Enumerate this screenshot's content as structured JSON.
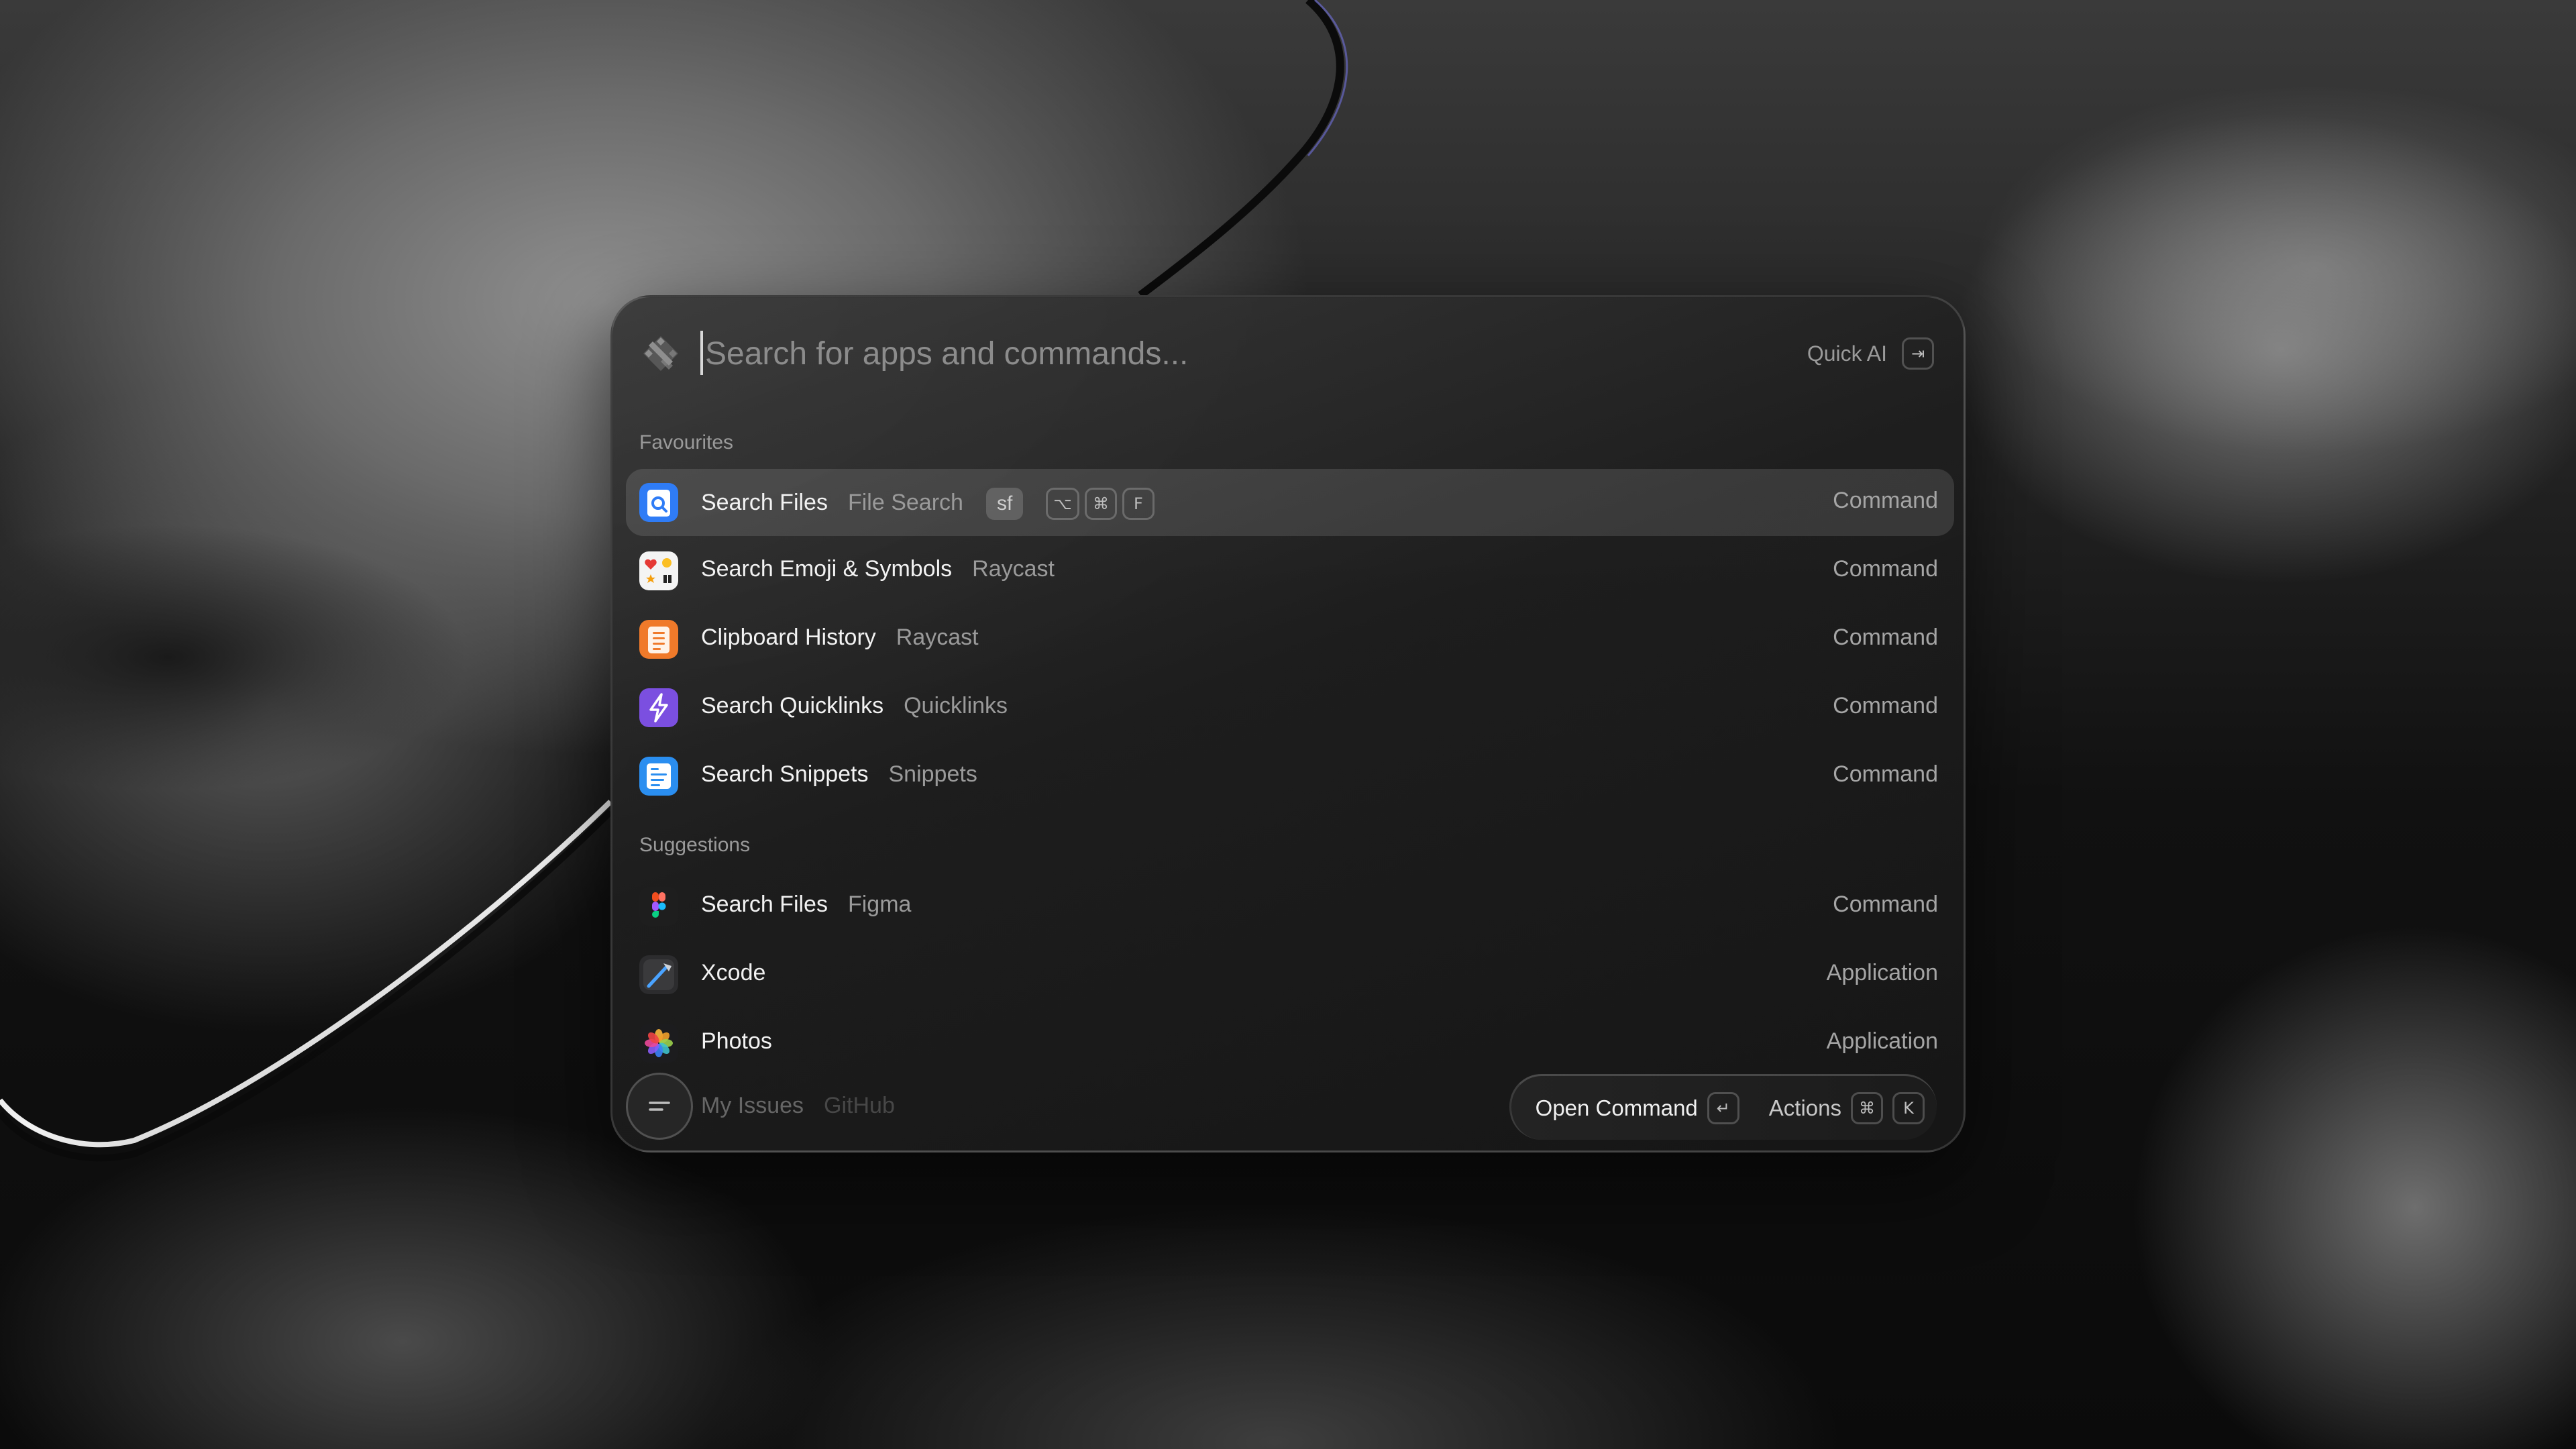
{
  "search": {
    "placeholder": "Search for apps and commands...",
    "quick_ai_label": "Quick AI",
    "quick_ai_key": "⇥"
  },
  "sections": {
    "favourites": "Favourites",
    "suggestions": "Suggestions"
  },
  "favourites": [
    {
      "title": "Search Files",
      "subtitle": "File Search",
      "alias": "sf",
      "hotkeys": [
        "⌥",
        "⌘",
        "F"
      ],
      "accessory": "Command",
      "icon": "file-search-icon"
    },
    {
      "title": "Search Emoji & Symbols",
      "subtitle": "Raycast",
      "accessory": "Command",
      "icon": "emoji-icon"
    },
    {
      "title": "Clipboard History",
      "subtitle": "Raycast",
      "accessory": "Command",
      "icon": "clipboard-icon"
    },
    {
      "title": "Search Quicklinks",
      "subtitle": "Quicklinks",
      "accessory": "Command",
      "icon": "quicklinks-icon"
    },
    {
      "title": "Search Snippets",
      "subtitle": "Snippets",
      "accessory": "Command",
      "icon": "snippets-icon"
    }
  ],
  "suggestions": [
    {
      "title": "Search Files",
      "subtitle": "Figma",
      "accessory": "Command",
      "icon": "figma-icon"
    },
    {
      "title": "Xcode",
      "subtitle": "",
      "accessory": "Application",
      "icon": "xcode-icon"
    },
    {
      "title": "Photos",
      "subtitle": "",
      "accessory": "Application",
      "icon": "photos-icon"
    },
    {
      "title": "My Issues",
      "subtitle": "GitHub",
      "accessory": "",
      "icon": "github-icon"
    }
  ],
  "footer": {
    "primary_action": "Open Command",
    "primary_key": "↵",
    "actions_label": "Actions",
    "actions_keys": [
      "⌘",
      "K"
    ]
  },
  "colors": {
    "file_search": "#2f7cf6",
    "clipboard": "#f07a2a",
    "quicklinks": "#7b4fe0",
    "snippets": "#2a8ef0"
  }
}
